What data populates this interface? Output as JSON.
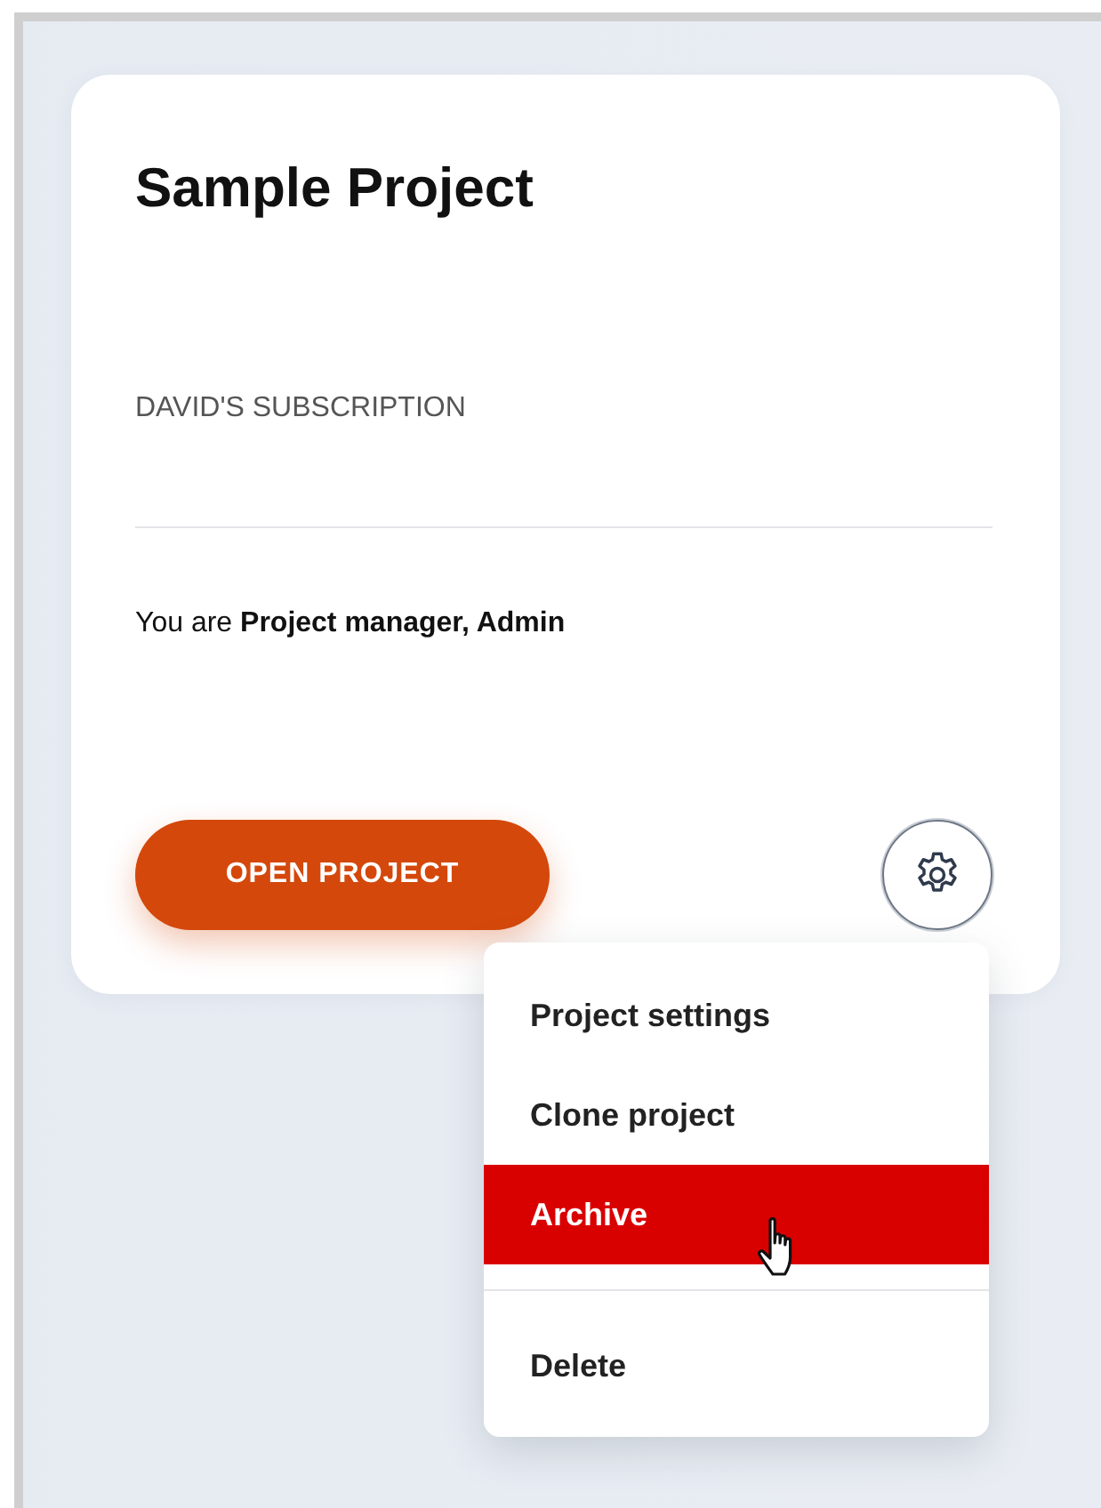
{
  "card": {
    "title": "Sample Project",
    "subscription": "DAVID'S SUBSCRIPTION",
    "role_line": "You are **Project manager, Admin**",
    "open_button": "OPEN PROJECT",
    "settings_expanded": true
  },
  "menu": {
    "groups": [
      {
        "items": [
          {
            "label": "Project settings",
            "selected": false
          },
          {
            "label": "Clone project",
            "selected": false
          },
          {
            "label": "Archive",
            "selected": true
          }
        ]
      },
      {
        "items": [
          {
            "label": "Delete",
            "selected": false
          }
        ]
      }
    ]
  }
}
